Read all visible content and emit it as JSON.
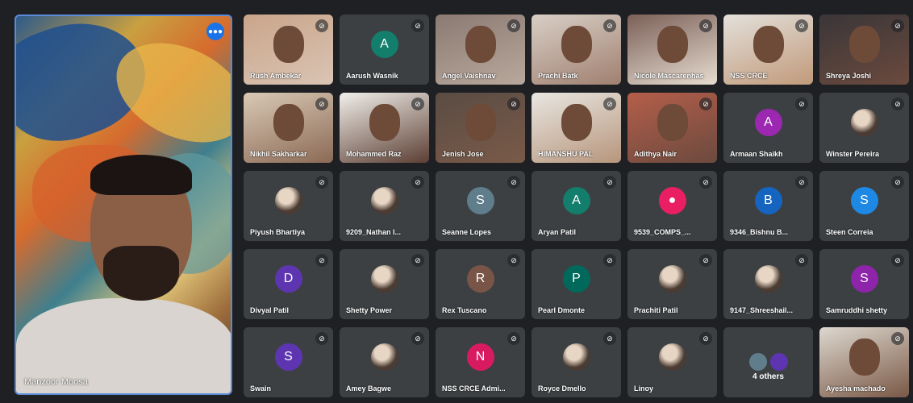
{
  "speaker": {
    "name": "Manzoor Moosa",
    "speaking_icon": "audio-indicator-icon"
  },
  "colors": {
    "background": "#202124",
    "tile": "#3c4043",
    "active_border": "#5b8bd8"
  },
  "participants": [
    {
      "name": "Rush Ambekar",
      "type": "video"
    },
    {
      "name": "Aarush Wasnik",
      "type": "avatar",
      "initial": "A",
      "color": "#137e6b"
    },
    {
      "name": "Angel Vaishnav",
      "type": "video"
    },
    {
      "name": "Prachi Batk",
      "type": "video"
    },
    {
      "name": "Nicole Mascarenhas",
      "type": "video"
    },
    {
      "name": "NSS CRCE",
      "type": "video"
    },
    {
      "name": "Shreya Joshi",
      "type": "video"
    },
    {
      "name": "Nikhil Sakharkar",
      "type": "video"
    },
    {
      "name": "Mohammed Raz",
      "type": "video"
    },
    {
      "name": "Jenish Jose",
      "type": "video"
    },
    {
      "name": "HIMANSHU PAL",
      "type": "video"
    },
    {
      "name": "Adithya Nair",
      "type": "video"
    },
    {
      "name": "Armaan Shaikh",
      "type": "avatar",
      "initial": "A",
      "color": "#9c27b0"
    },
    {
      "name": "Winster Pereira",
      "type": "image"
    },
    {
      "name": "Piyush Bhartiya",
      "type": "image"
    },
    {
      "name": "9209_Nathan I...",
      "type": "image"
    },
    {
      "name": "Seanne Lopes",
      "type": "avatar",
      "initial": "S",
      "color": "#607d8b"
    },
    {
      "name": "Aryan Patil",
      "type": "avatar",
      "initial": "A",
      "color": "#137e6b"
    },
    {
      "name": "9539_COMPS_...",
      "type": "avatar",
      "initial": "●",
      "color": "#e91e63"
    },
    {
      "name": "9346_Bishnu B...",
      "type": "avatar",
      "initial": "B",
      "color": "#1565c0"
    },
    {
      "name": "Steen Correia",
      "type": "avatar",
      "initial": "S",
      "color": "#1e88e5"
    },
    {
      "name": "Divyal Patil",
      "type": "avatar",
      "initial": "D",
      "color": "#5e35b1"
    },
    {
      "name": "Shetty Power",
      "type": "image"
    },
    {
      "name": "Rex Tuscano",
      "type": "avatar",
      "initial": "R",
      "color": "#795548"
    },
    {
      "name": "Pearl Dmonte",
      "type": "avatar",
      "initial": "P",
      "color": "#00695c"
    },
    {
      "name": "Prachiti Patil",
      "type": "image"
    },
    {
      "name": "9147_Shreeshail...",
      "type": "image"
    },
    {
      "name": "Samruddhi shetty",
      "type": "avatar",
      "initial": "S",
      "color": "#8e24aa"
    },
    {
      "name": "Swain",
      "type": "avatar",
      "initial": "S",
      "color": "#5e35b1"
    },
    {
      "name": "Amey Bagwe",
      "type": "image"
    },
    {
      "name": "NSS CRCE Admi...",
      "type": "avatar",
      "initial": "N",
      "color": "#d81b60"
    },
    {
      "name": "Royce Dmello",
      "type": "image"
    },
    {
      "name": "Linoy",
      "type": "image"
    },
    {
      "name": "4 others",
      "type": "others"
    },
    {
      "name": "Ayesha machado",
      "type": "video"
    }
  ]
}
